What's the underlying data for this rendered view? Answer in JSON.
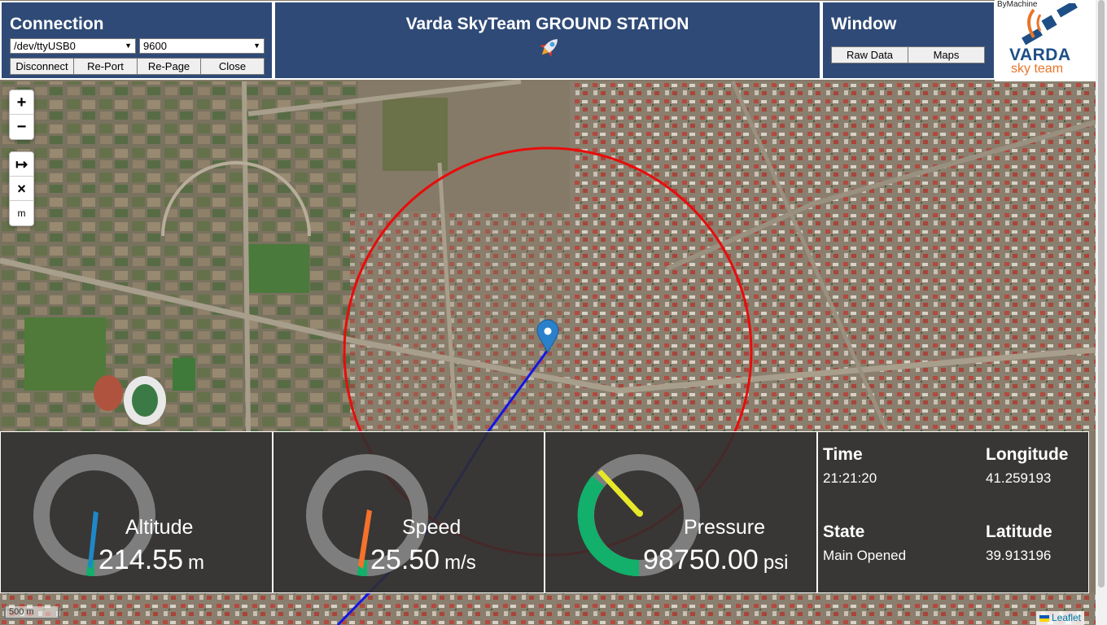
{
  "connection": {
    "title": "Connection",
    "port_value": "/dev/ttyUSB0",
    "baud_value": "9600",
    "buttons": [
      "Disconnect",
      "Re-Port",
      "Re-Page",
      "Close"
    ]
  },
  "header": {
    "title": "Varda SkyTeam GROUND STATION"
  },
  "window_panel": {
    "title": "Window",
    "buttons": [
      "Raw Data",
      "Maps"
    ]
  },
  "logo": {
    "credit": "ByMachine",
    "line1": "VARDA",
    "line2": "sky team"
  },
  "map": {
    "zoom_in": "+",
    "zoom_out": "−",
    "tool_polyline": "↦",
    "tool_clear": "×",
    "tool_measure": "m",
    "scale": "500 m",
    "attribution": "Leaflet",
    "colors": {
      "track": "#1515e6",
      "radius": "#e80c0c",
      "marker": "#2a81cb"
    }
  },
  "gauges": {
    "altitude": {
      "label": "Altitude",
      "value": "214.55",
      "unit": "m",
      "color": "#1f87c8"
    },
    "speed": {
      "label": "Speed",
      "value": "25.50",
      "unit": "m/s",
      "color": "#f4722b"
    },
    "pressure": {
      "label": "Pressure",
      "value": "98750.00",
      "unit": "psi",
      "color": "#e8e82a",
      "fill_color": "#12b06a"
    }
  },
  "info": {
    "time_label": "Time",
    "time_value": "21:21:20",
    "longitude_label": "Longitude",
    "longitude_value": "41.259193",
    "state_label": "State",
    "state_value": "Main Opened",
    "latitude_label": "Latitude",
    "latitude_value": "39.913196"
  }
}
